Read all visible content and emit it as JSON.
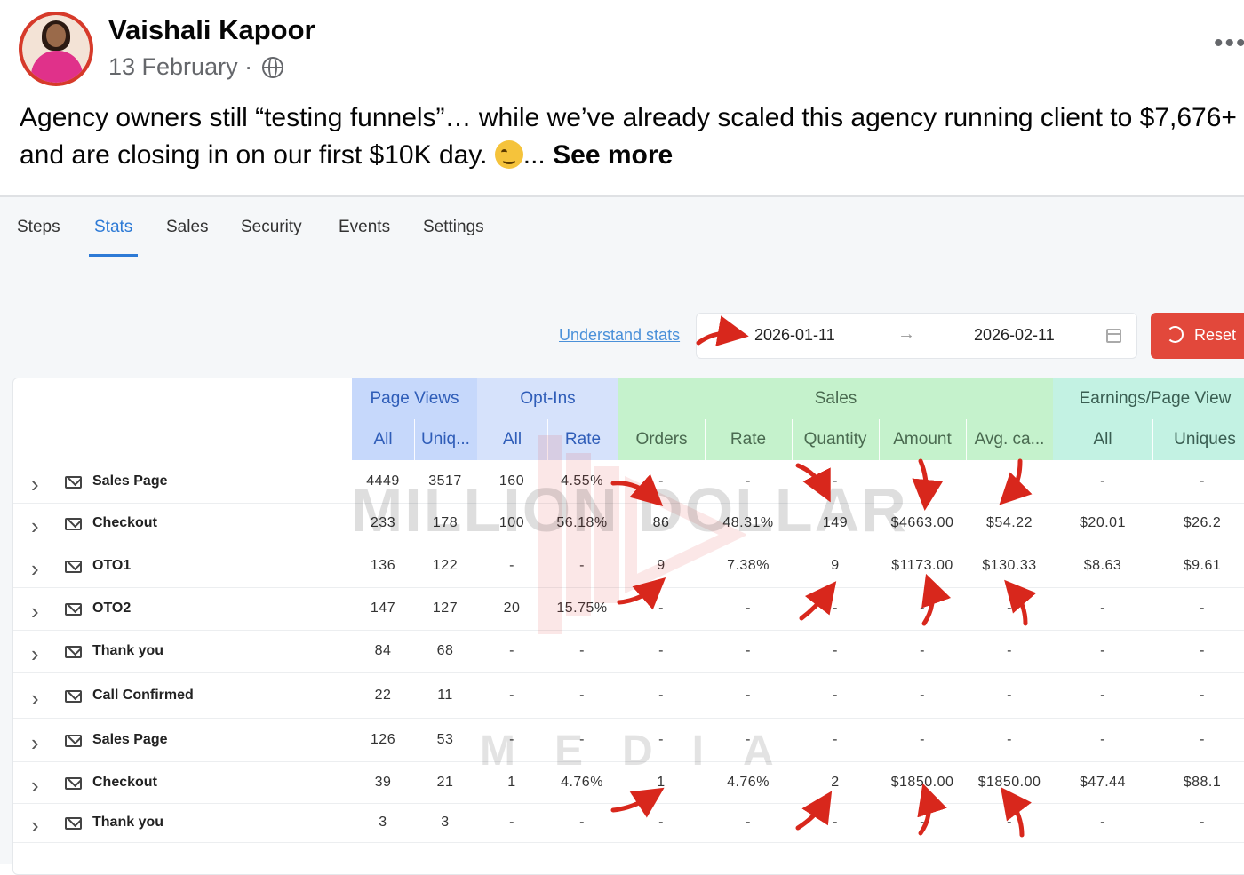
{
  "post": {
    "author": "Vaishali Kapoor",
    "date": "13 February",
    "date_sep": "·",
    "more": "•••",
    "text": "Agency owners still “testing funnels”… while we’ve already scaled this agency running client to $7,676+ and are closing in on our first $10K day.",
    "ellipsis": "...",
    "see_more": "See more"
  },
  "tabs": [
    "Steps",
    "Stats",
    "Sales",
    "Security",
    "Events",
    "Settings"
  ],
  "active_tab": "Stats",
  "toolbar": {
    "understand_link": "Understand stats",
    "date_start": "2026-01-11",
    "date_sep": "→",
    "date_end": "2026-02-11",
    "reset_label": "Reset"
  },
  "table": {
    "groups": [
      "Page Views",
      "Opt-Ins",
      "Sales",
      "Earnings/Page View"
    ],
    "columns": [
      "All",
      "Uniq...",
      "All",
      "Rate",
      "Orders",
      "Rate",
      "Quantity",
      "Amount",
      "Avg. ca...",
      "All",
      "Uniques"
    ],
    "rows": [
      {
        "name": "Sales Page",
        "values": [
          "4449",
          "3517",
          "160",
          "4.55%",
          "-",
          "-",
          "-",
          "-",
          "-",
          "-",
          "-"
        ]
      },
      {
        "name": "Checkout",
        "values": [
          "233",
          "178",
          "100",
          "56.18%",
          "86",
          "48.31%",
          "149",
          "$4663.00",
          "$54.22",
          "$20.01",
          "$26.2"
        ]
      },
      {
        "name": "OTO1",
        "values": [
          "136",
          "122",
          "-",
          "-",
          "9",
          "7.38%",
          "9",
          "$1173.00",
          "$130.33",
          "$8.63",
          "$9.61"
        ]
      },
      {
        "name": "OTO2",
        "values": [
          "147",
          "127",
          "20",
          "15.75%",
          "-",
          "-",
          "-",
          "-",
          "-",
          "-",
          "-"
        ]
      },
      {
        "name": "Thank you",
        "values": [
          "84",
          "68",
          "-",
          "-",
          "-",
          "-",
          "-",
          "-",
          "-",
          "-",
          "-"
        ]
      },
      {
        "name": "Call Confirmed",
        "values": [
          "22",
          "11",
          "-",
          "-",
          "-",
          "-",
          "-",
          "-",
          "-",
          "-",
          "-"
        ]
      },
      {
        "name": "Sales Page",
        "values": [
          "126",
          "53",
          "-",
          "-",
          "-",
          "-",
          "-",
          "-",
          "-",
          "-",
          "-"
        ]
      },
      {
        "name": "Checkout",
        "values": [
          "39",
          "21",
          "1",
          "4.76%",
          "1",
          "4.76%",
          "2",
          "$1850.00",
          "$1850.00",
          "$47.44",
          "$88.1"
        ]
      },
      {
        "name": "Thank you",
        "values": [
          "3",
          "3",
          "-",
          "-",
          "-",
          "-",
          "-",
          "-",
          "-",
          "-",
          "-"
        ]
      }
    ]
  },
  "watermark": {
    "line1": "MILLION DOLLAR",
    "line2": "MEDIA"
  },
  "colors": {
    "accent_blue": "#2d7ad6",
    "reset_red": "#e2483b",
    "annotation_red": "#d8271c"
  },
  "icons": {
    "row": "envelope-icon",
    "expand": "chevron-right-icon",
    "reset": "refresh-icon",
    "date": "calendar-icon",
    "privacy": "globe-icon"
  }
}
